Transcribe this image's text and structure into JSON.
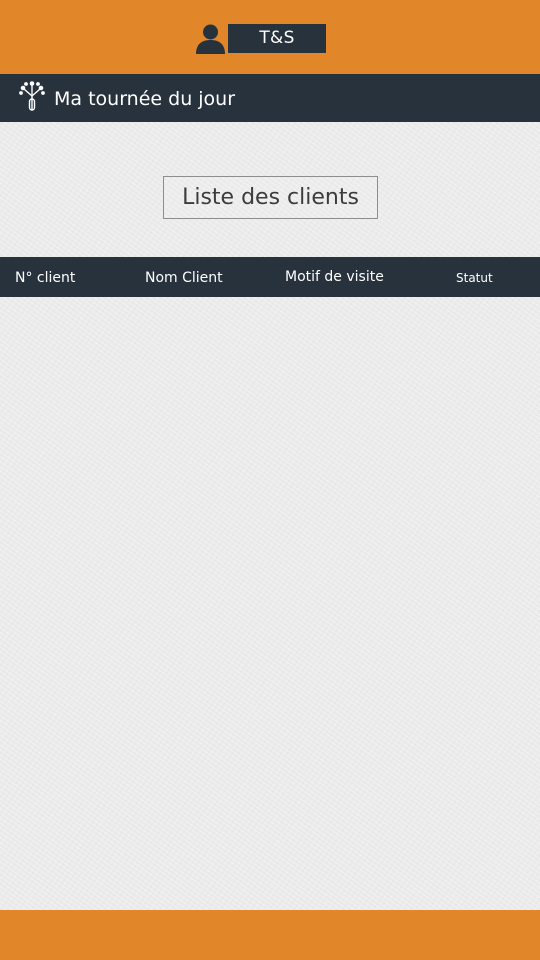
{
  "header": {
    "user_badge": "T&S",
    "user_icon": "user-icon",
    "accent_color": "#e2862a"
  },
  "title_bar": {
    "icon": "branches-icon",
    "title": "Ma tournée du jour",
    "background_color": "#27323d"
  },
  "main": {
    "list_button_label": "Liste des clients"
  },
  "table": {
    "columns": [
      "N° client",
      "Nom Client",
      "Motif de visite",
      "Statut"
    ],
    "rows": []
  }
}
